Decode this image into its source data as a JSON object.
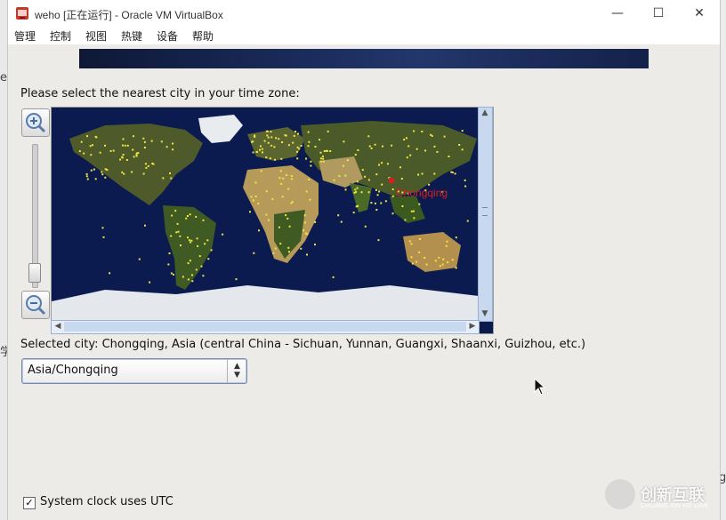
{
  "window": {
    "title": "weho [正在运行] - Oracle VM VirtualBox"
  },
  "window_controls": {
    "minimize": "—",
    "maximize": "☐",
    "close": "✕"
  },
  "menu": {
    "items": [
      "管理",
      "控制",
      "视图",
      "热键",
      "设备",
      "帮助"
    ]
  },
  "background": {
    "left_glyph_1": "e",
    "left_glyph_2": "学",
    "right_glyph": "g"
  },
  "installer": {
    "prompt": "Please select the nearest city in your time zone:",
    "map": {
      "highlighted_city": "Chongqing",
      "marker_color": "#d42020",
      "city_dot_color": "#f2e640"
    },
    "selected_city": "Selected city: Chongqing, Asia (central China - Sichuan, Yunnan, Guangxi, Shaanxi, Guizhou, etc.)",
    "timezone_select": {
      "value": "Asia/Chongqing"
    },
    "utc_checkbox": {
      "label": "System clock uses UTC",
      "checked": true
    }
  },
  "icons": {
    "zoom_in": "magnifier-plus-icon",
    "zoom_out": "magnifier-minus-icon",
    "select_arrows": "updown-chevron-icon"
  },
  "watermark": {
    "text": "创新互联",
    "sub": "CHUANG XIN HU LIAN"
  }
}
